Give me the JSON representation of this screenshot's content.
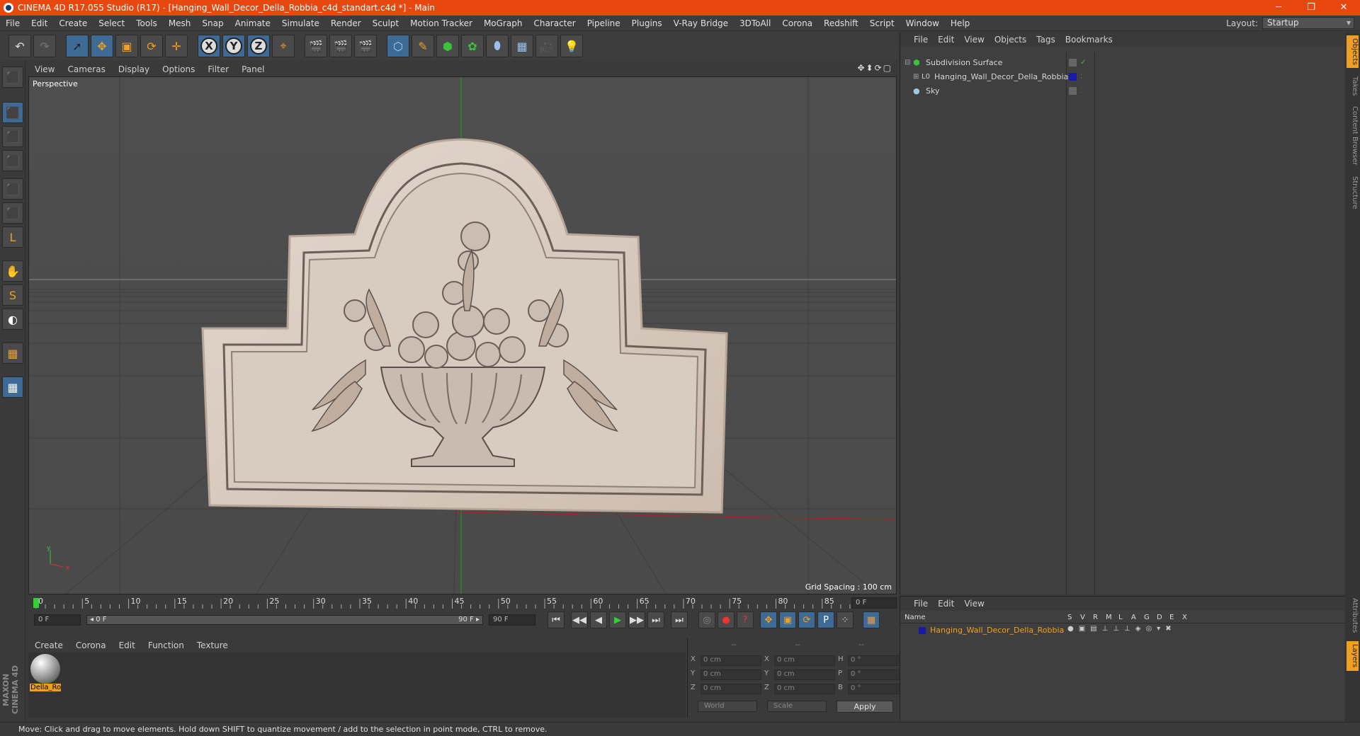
{
  "window": {
    "title": "CINEMA 4D R17.055 Studio (R17) - [Hanging_Wall_Decor_Della_Robbia_c4d_standart.c4d *] - Main",
    "minimize": "─",
    "maximize": "❐",
    "close": "✕"
  },
  "menu": [
    "File",
    "Edit",
    "Create",
    "Select",
    "Tools",
    "Mesh",
    "Snap",
    "Animate",
    "Simulate",
    "Render",
    "Sculpt",
    "Motion Tracker",
    "MoGraph",
    "Character",
    "Pipeline",
    "Plugins",
    "V-Ray Bridge",
    "3DToAll",
    "Corona",
    "Redshift",
    "Script",
    "Window",
    "Help"
  ],
  "layout": {
    "label": "Layout:",
    "value": "Startup"
  },
  "toolbar": {
    "undo": "↶",
    "redo": "↷",
    "select": "➚",
    "move": "✥",
    "scale": "▣",
    "rotate": "⟳",
    "transform": "✛",
    "x": "X",
    "y": "Y",
    "z": "Z",
    "coord": "⌖",
    "render_view": "🎬",
    "render_pic": "🎬",
    "render_settings": "🎬",
    "cube": "⬡",
    "pen": "✎",
    "subdiv": "⬢",
    "array": "✿",
    "deformer": "⬮",
    "floor": "▦",
    "camera": "🎥",
    "light": "💡"
  },
  "lefttools": [
    "⬛",
    "⬛",
    "⬛",
    "⬛",
    "⬛",
    "⬛",
    "L",
    "✋",
    "S",
    "◐",
    "▦",
    "▦"
  ],
  "viewport": {
    "menu": [
      "View",
      "Cameras",
      "Display",
      "Options",
      "Filter",
      "Panel"
    ],
    "nav_icons": "✥⬍⟳▢",
    "label": "Perspective",
    "grid_spacing": "Grid Spacing : 100 cm",
    "axis_y": "y",
    "axis_x": "x"
  },
  "timeline": {
    "ticks": [
      "0",
      "5",
      "10",
      "15",
      "20",
      "25",
      "30",
      "35",
      "40",
      "45",
      "50",
      "55",
      "60",
      "65",
      "70",
      "75",
      "80",
      "85",
      "90"
    ],
    "current_frame": "0 F",
    "start": "0 F",
    "range_start": "◂ 0 F",
    "range_end": "90 F ▸",
    "end": "90 F"
  },
  "transport": [
    "⏮",
    "◀◀",
    "◀",
    "▶",
    "▶▶",
    "⏭",
    "⏭"
  ],
  "keyframe_icons": [
    "◎",
    "●",
    "?",
    "✥",
    "▣",
    "⟳",
    "P",
    "⁘",
    "▦"
  ],
  "material_manager": {
    "menu": [
      "Create",
      "Corona",
      "Edit",
      "Function",
      "Texture"
    ],
    "material_name": "Della_Ro"
  },
  "coords": {
    "header": [
      "--",
      "--",
      "--"
    ],
    "rows": [
      {
        "a": "X",
        "av": "0 cm",
        "b": "X",
        "bv": "0 cm",
        "c": "H",
        "cv": "0 °"
      },
      {
        "a": "Y",
        "av": "0 cm",
        "b": "Y",
        "bv": "0 cm",
        "c": "P",
        "cv": "0 °"
      },
      {
        "a": "Z",
        "av": "0 cm",
        "b": "Z",
        "bv": "0 cm",
        "c": "B",
        "cv": "0 °"
      }
    ],
    "world": "World",
    "scale": "Scale",
    "apply": "Apply"
  },
  "status": "Move: Click and drag to move elements. Hold down SHIFT to quantize movement / add to the selection in point mode, CTRL to remove.",
  "maxon": "MAXON CINEMA 4D",
  "object_manager": {
    "menu": [
      "File",
      "Edit",
      "View",
      "Objects",
      "Tags",
      "Bookmarks"
    ],
    "objects": [
      {
        "name": "Subdivision Surface",
        "icon": "⬢",
        "color": "#3ac43a"
      },
      {
        "name": "Hanging_Wall_Decor_Della_Robbia",
        "icon": "L0",
        "color": "#cccccc"
      },
      {
        "name": "Sky",
        "icon": "●",
        "color": "#9ec8e8"
      }
    ]
  },
  "attribute_manager": {
    "menu": [
      "File",
      "Edit",
      "View"
    ],
    "col_name": "Name",
    "cols": [
      "S",
      "V",
      "R",
      "M",
      "L",
      "A",
      "G",
      "D",
      "E",
      "X"
    ],
    "layer": {
      "name": "Hanging_Wall_Decor_Della_Robbia",
      "color": "#1a1aaa"
    }
  },
  "right_tabs": [
    "Objects",
    "Takes",
    "Content Browser",
    "Structure",
    "Attributes",
    "Layers"
  ]
}
